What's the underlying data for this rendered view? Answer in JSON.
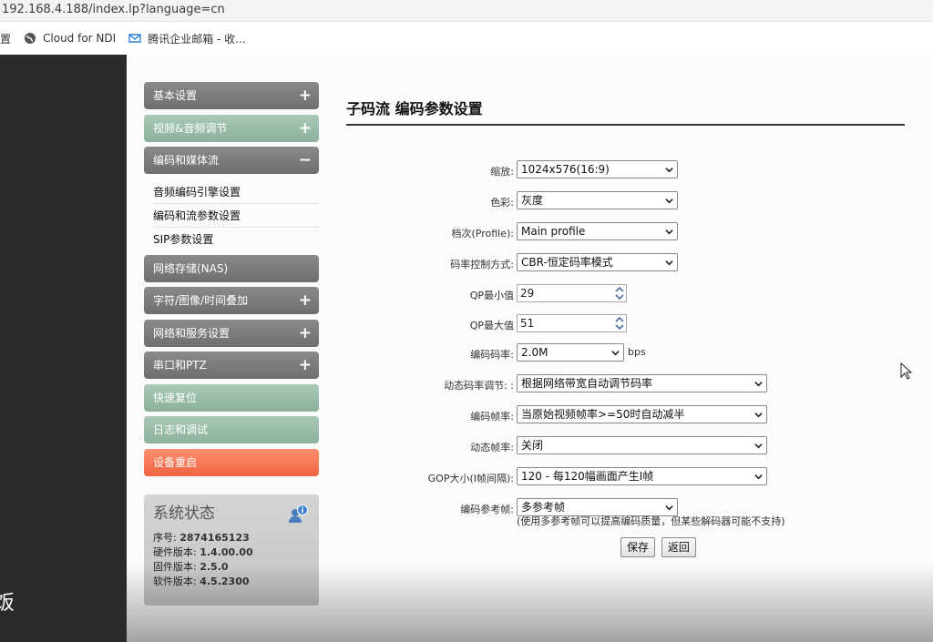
{
  "browser": {
    "url": "192.168.4.188/index.lp?language=cn",
    "bookmarks": [
      {
        "label": "置",
        "icon": "settings-icon"
      },
      {
        "label": "Cloud for NDI",
        "icon": "globe-icon"
      },
      {
        "label": "腾讯企业邮箱 - 收...",
        "icon": "mail-icon"
      }
    ]
  },
  "left_strip": {
    "glyph": "饭"
  },
  "sidebar": {
    "menus": [
      {
        "label": "基本设置",
        "sign": "+",
        "style": "gray"
      },
      {
        "label": "视频&音频调节",
        "sign": "+",
        "style": "green"
      },
      {
        "label": "编码和媒体流",
        "sign": "−",
        "style": "gray"
      },
      {
        "label": "网络存储(NAS)",
        "sign": "",
        "style": "gray"
      },
      {
        "label": "字符/图像/时间叠加",
        "sign": "+",
        "style": "gray"
      },
      {
        "label": "网络和服务设置",
        "sign": "+",
        "style": "gray"
      },
      {
        "label": "串口和PTZ",
        "sign": "+",
        "style": "gray"
      },
      {
        "label": "快速复位",
        "sign": "",
        "style": "green"
      },
      {
        "label": "日志和调试",
        "sign": "",
        "style": "green"
      },
      {
        "label": "设备重启",
        "sign": "",
        "style": "red"
      }
    ],
    "submenu": [
      "音频编码引擎设置",
      "编码和流参数设置",
      "SIP参数设置"
    ]
  },
  "status": {
    "title": "系统状态",
    "rows": [
      {
        "label": "序号:",
        "value": "2874165123"
      },
      {
        "label": "硬件版本:",
        "value": "1.4.00.00"
      },
      {
        "label": "固件版本:",
        "value": "2.5.0"
      },
      {
        "label": "软件版本:",
        "value": "4.5.2300"
      }
    ]
  },
  "main": {
    "title": "子码流 编码参数设置",
    "fields": [
      {
        "label": "缩放:",
        "type": "select",
        "value": "1024x576(16:9)"
      },
      {
        "label": "色彩:",
        "type": "select",
        "value": "灰度"
      },
      {
        "label": "档次(Profile):",
        "type": "select",
        "value": "Main profile"
      },
      {
        "label": "码率控制方式:",
        "type": "select",
        "value": "CBR-恒定码率模式"
      },
      {
        "label": "QP最小值",
        "type": "spin",
        "value": "29"
      },
      {
        "label": "QP最大值",
        "type": "spin",
        "value": "51"
      },
      {
        "label": "编码码率:",
        "type": "select",
        "value": "2.0M",
        "unit": "bps"
      },
      {
        "label": "动态码率调节: :",
        "type": "select",
        "value": "根据网络带宽自动调节码率"
      },
      {
        "label": "编码帧率:",
        "type": "select",
        "value": "当原始视频帧率>=50时自动减半"
      },
      {
        "label": "动态帧率:",
        "type": "select",
        "value": "关闭"
      },
      {
        "label": "GOP大小(I帧间隔):",
        "type": "select",
        "value": "120 - 每120幅画面产生I帧"
      },
      {
        "label": "编码参考帧:",
        "type": "select",
        "value": "多参考帧"
      }
    ],
    "note": "(使用多参考帧可以提高编码质量，但某些解码器可能不支持)",
    "save_label": "保存",
    "back_label": "返回"
  }
}
